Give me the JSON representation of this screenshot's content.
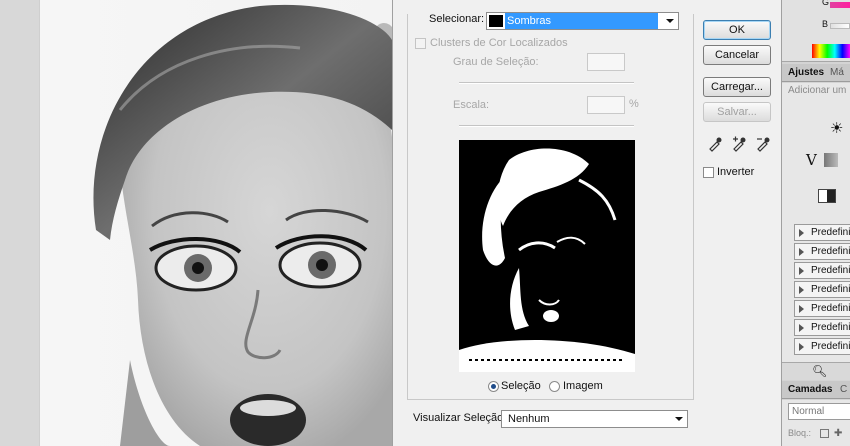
{
  "dialog": {
    "select_label": "Selecionar:",
    "select_value": "Sombras",
    "localized_clusters_label": "Clusters de Cor Localizados",
    "fuzziness_label": "Grau de Seleção:",
    "range_label": "Escala:",
    "range_unit": "%",
    "radio_selection": "Seleção",
    "radio_image": "Imagem",
    "preview_label": "Visualizar Seleção:",
    "preview_value": "Nenhum",
    "ok_button": "OK",
    "cancel_button": "Cancelar",
    "load_button": "Carregar...",
    "save_button": "Salvar...",
    "invert_label": "Inverter"
  },
  "right_panel": {
    "tab_adjustments": "Ajustes",
    "tab_masks": "Má",
    "add_hint": "Adicionar um",
    "color_label_g": "G",
    "color_label_b": "B",
    "presets": [
      "Predefini",
      "Predefini",
      "Predefini",
      "Predefini",
      "Predefini",
      "Predefini",
      "Predefini"
    ],
    "tab_layers": "Camadas",
    "tab_channels": "C",
    "blend_mode": "Normal",
    "lock_label": "Bloq.:"
  },
  "colors": {
    "dialog_bg": "#f0f0f0",
    "selection_highlight": "#3399ff",
    "panel_bg": "#d4d4d4"
  }
}
